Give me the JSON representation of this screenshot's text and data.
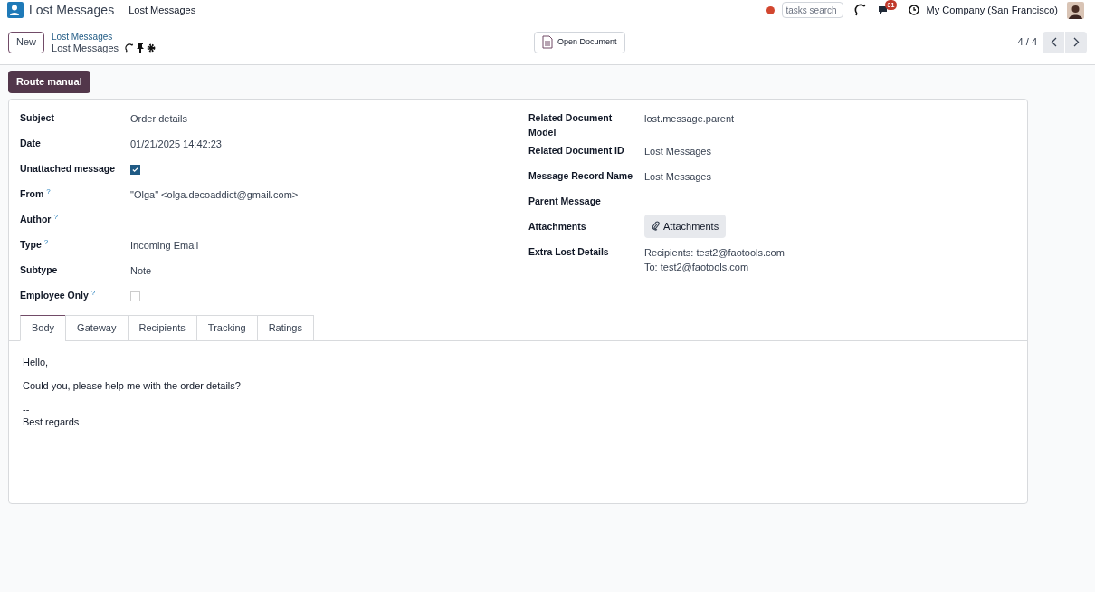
{
  "navbar": {
    "app_title": "Lost Messages",
    "menu": [
      "Lost Messages"
    ],
    "search": {
      "placeholder": "tasks search"
    },
    "message_count": "31",
    "company": "My Company (San Francisco)"
  },
  "control_panel": {
    "new_button": "New",
    "breadcrumb_parent": "Lost Messages",
    "breadcrumb_current": "Lost Messages",
    "open_document": "Open Document",
    "pager": "4 / 4"
  },
  "action_button": "Route manual",
  "fields_left": [
    {
      "label": "Subject",
      "kind": "text",
      "value": "Order details"
    },
    {
      "label": "Date",
      "kind": "text",
      "value": "01/21/2025 14:42:23"
    },
    {
      "label": "Unattached message",
      "kind": "checkbox",
      "checked": true
    },
    {
      "label": "From",
      "help": "?",
      "kind": "text",
      "value": "\"Olga\" <olga.decoaddict@gmail.com>"
    },
    {
      "label": "Author",
      "help": "?",
      "kind": "text"
    },
    {
      "label": "Type",
      "help": "?",
      "kind": "text",
      "value": "Incoming Email"
    },
    {
      "label": "Subtype",
      "kind": "text",
      "value": "Note"
    },
    {
      "label": "Employee Only",
      "help": "?",
      "kind": "checkbox",
      "checked": false
    }
  ],
  "fields_right": [
    {
      "label": "Related Document Model",
      "kind": "text",
      "value": "lost.message.parent"
    },
    {
      "label": "Related Document ID",
      "kind": "text",
      "value": "Lost Messages"
    },
    {
      "label": "Message Record Name",
      "kind": "text",
      "value": "Lost Messages"
    },
    {
      "label": "Parent Message",
      "kind": "text"
    },
    {
      "label": "Attachments",
      "kind": "button",
      "value": "Attachments"
    },
    {
      "label": "Extra Lost Details",
      "kind": "lines",
      "lines": [
        "Recipients: test2@faotools.com",
        "To: test2@faotools.com"
      ]
    }
  ],
  "tabs": [
    {
      "label": "Body",
      "selected": true
    },
    {
      "label": "Gateway",
      "selected": false
    },
    {
      "label": "Recipients",
      "selected": false
    },
    {
      "label": "Tracking",
      "selected": false
    },
    {
      "label": "Ratings",
      "selected": false
    }
  ],
  "body": [
    "Hello,",
    "Could you, please help me with the order details?",
    "--\nBest regards"
  ]
}
